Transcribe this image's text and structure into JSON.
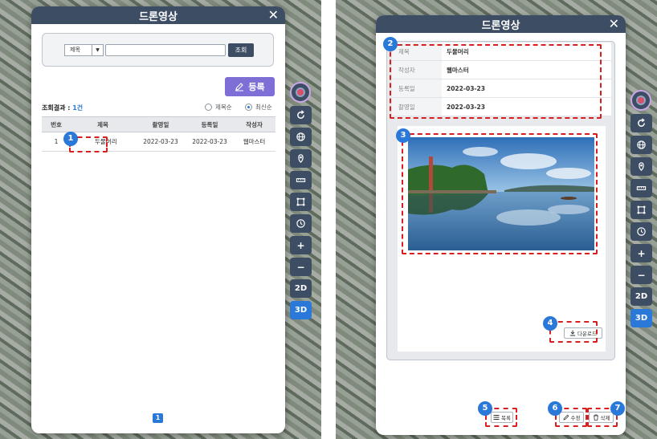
{
  "list_panel": {
    "title": "드론영상",
    "close_label": "✕",
    "search": {
      "select_value": "제목",
      "select_arrow": "▼",
      "input_value": "",
      "button_label": "조회"
    },
    "register_label": "등록",
    "result_label": "조회결과 : ",
    "result_count": "1건",
    "sort": {
      "option_title": "제목순",
      "option_recent": "최신순"
    },
    "columns": [
      "번호",
      "제목",
      "촬영일",
      "등록일",
      "작성자"
    ],
    "rows": [
      {
        "no": "1",
        "title": "두물머리",
        "shot_date": "2022-03-23",
        "reg_date": "2022-03-23",
        "author": "웹마스터"
      }
    ],
    "page": "1"
  },
  "detail_panel": {
    "title": "드론영상",
    "close_label": "✕",
    "fields": [
      {
        "label": "제목",
        "value": "두물머리"
      },
      {
        "label": "작성자",
        "value": "웹마스터"
      },
      {
        "label": "등록일",
        "value": "2022-03-23"
      },
      {
        "label": "촬영일",
        "value": "2022-03-23"
      }
    ],
    "download_label": "다운로드",
    "list_label": "목록",
    "edit_label": "수정",
    "delete_label": "삭제"
  },
  "toolbar": {
    "btn_2d": "2D",
    "btn_3d": "3D",
    "zoom_in": "+",
    "zoom_out": "−"
  },
  "badges": [
    "1",
    "2",
    "3",
    "4",
    "5",
    "6",
    "7"
  ],
  "colors": {
    "header": "#3d4d63",
    "accent": "#2a78d8",
    "register": "#7d6fd6",
    "annotation": "#d81f1f"
  }
}
